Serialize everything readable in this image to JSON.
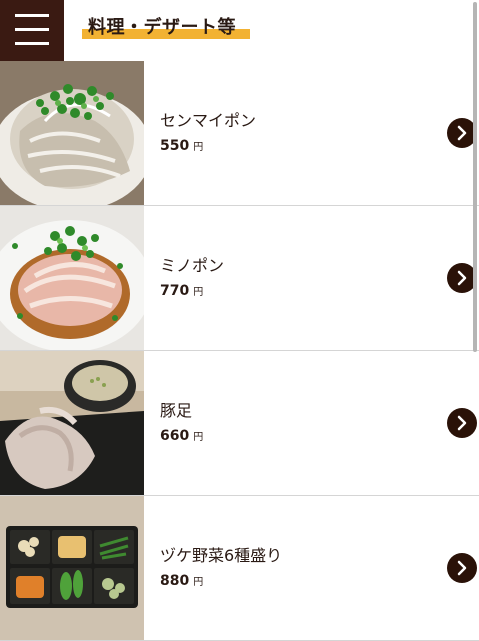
{
  "header": {
    "menu_icon": "hamburger-menu-icon",
    "title": "料理・デザート等",
    "title_highlight_color": "#f2b233",
    "menu_bg_color": "#3a1a12"
  },
  "menu_items": [
    {
      "name": "センマイポン",
      "price": "550",
      "currency": "円",
      "image": "senmai-dish-photo"
    },
    {
      "name": "ミノポン",
      "price": "770",
      "currency": "円",
      "image": "mino-dish-photo"
    },
    {
      "name": "豚足",
      "price": "660",
      "currency": "円",
      "image": "tonsoku-dish-photo"
    },
    {
      "name": "ヅケ野菜6種盛り",
      "price": "880",
      "currency": "円",
      "image": "pickled-vegetables-photo"
    }
  ],
  "arrow_icon": "chevron-right-circle-icon",
  "arrow_color": "#2a1208"
}
